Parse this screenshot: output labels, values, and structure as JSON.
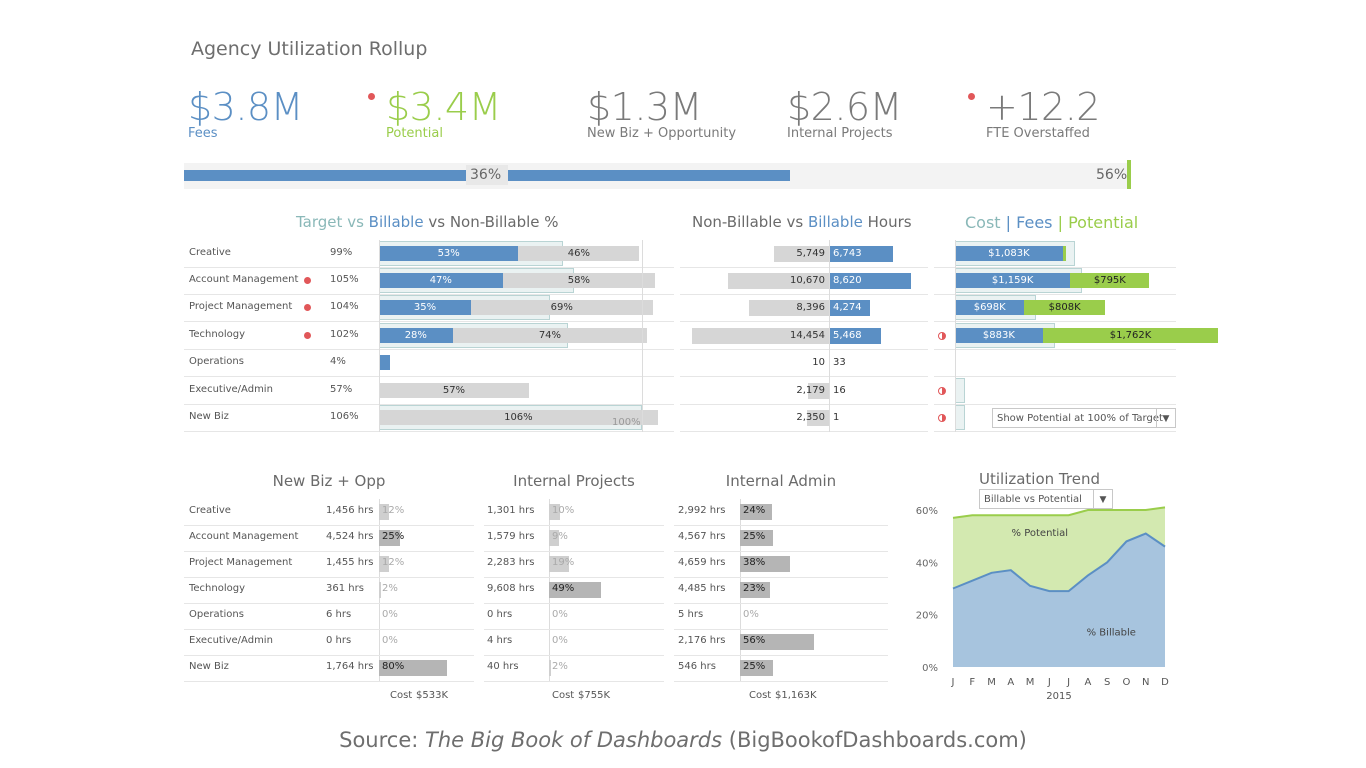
{
  "title": "Agency Utilization Rollup",
  "colors": {
    "blue": "#5b8fc4",
    "green": "#9acd4b",
    "teal": "#8ab8b8",
    "gray": "#d6d6d6",
    "red": "#e15759",
    "dark_gray": "#b5b5b5"
  },
  "kpis": [
    {
      "value": "$3.8M",
      "label": "Fees",
      "color": "#5b8fc4",
      "alert": false
    },
    {
      "value": "$3.4M",
      "label": "Potential",
      "color": "#9acd4b",
      "alert": true
    },
    {
      "value": "$1.3M",
      "label": "New Biz + Opportunity",
      "color": "#7a7a7a",
      "alert": false
    },
    {
      "value": "$2.6M",
      "label": "Internal Projects",
      "color": "#7a7a7a",
      "alert": false
    },
    {
      "value": "+12.2",
      "label": "FTE Overstaffed",
      "color": "#7a7a7a",
      "alert": true
    }
  ],
  "progress": {
    "fill_fraction": 0.64,
    "fill_label": "36%",
    "end_label": "56%"
  },
  "util_title": {
    "target": "Target",
    "vs1": "vs",
    "billable": "Billable",
    "rest": "vs Non-Billable %"
  },
  "hours_title": {
    "left": "Non-Billable vs",
    "billable": "Billable",
    "right": "Hours"
  },
  "money_title": {
    "cost": "Cost",
    "sep1": "|",
    "fees": "Fees",
    "sep2": "|",
    "potential": "Potential"
  },
  "departments": [
    {
      "name": "Creative",
      "alert": false,
      "util": "99%",
      "billable": 53,
      "nonbillable": 46,
      "target": 70,
      "nonbill_hrs": 5749,
      "bill_hrs": 6743,
      "cost_label": "$1,083K",
      "cost": 1083,
      "fees": 1083,
      "potential": null,
      "half": false
    },
    {
      "name": "Account Management",
      "alert": true,
      "util": "105%",
      "billable": 47,
      "nonbillable": 58,
      "target": 74,
      "nonbill_hrs": 10670,
      "bill_hrs": 8620,
      "cost_label": "$1,159K",
      "cost": 1159,
      "fees": 1159,
      "potential": 795,
      "potential_label": "$795K",
      "half": false
    },
    {
      "name": "Project Management",
      "alert": true,
      "util": "104%",
      "billable": 35,
      "nonbillable": 69,
      "target": 65,
      "nonbill_hrs": 8396,
      "bill_hrs": 4274,
      "cost_label": "$698K",
      "cost": 698,
      "fees": 698,
      "potential": 808,
      "potential_label": "$808K",
      "half": false
    },
    {
      "name": "Technology",
      "alert": true,
      "util": "102%",
      "billable": 28,
      "nonbillable": 74,
      "target": 72,
      "nonbill_hrs": 14454,
      "bill_hrs": 5468,
      "cost_label": "$883K",
      "cost": 883,
      "fees": 883,
      "potential": 1762,
      "potential_label": "$1,762K",
      "half": true
    },
    {
      "name": "Operations",
      "alert": false,
      "util": "4%",
      "billable": 4,
      "nonbillable": 0,
      "target": null,
      "nonbill_hrs": 10,
      "bill_hrs": 33,
      "cost_label": "",
      "cost": 0,
      "fees": 0,
      "potential": null,
      "half": false
    },
    {
      "name": "Executive/Admin",
      "alert": false,
      "util": "57%",
      "billable": 0,
      "nonbillable": 57,
      "target": null,
      "nonbill_hrs": 2179,
      "bill_hrs": 16,
      "cost_label": "",
      "cost": 0,
      "fees": 0,
      "potential": null,
      "half": true
    },
    {
      "name": "New Biz",
      "alert": false,
      "util": "106%",
      "billable": 0,
      "nonbillable": 106,
      "target": 100,
      "nonbill_hrs": 2350,
      "bill_hrs": 1,
      "cost_label": "",
      "cost": 0,
      "fees": 0,
      "potential": null,
      "half": true
    }
  ],
  "hours_labels": {
    "nonbill": [
      "5,749",
      "10,670",
      "8,396",
      "14,454",
      "10",
      "2,179",
      "2,350"
    ],
    "bill": [
      "6,743",
      "8,620",
      "4,274",
      "5,468",
      "33",
      "16",
      "1"
    ]
  },
  "nb_billable_labels": [
    "53%",
    "47%",
    "35%",
    "28%",
    "",
    "",
    ""
  ],
  "nb_nonbill_labels": [
    "46%",
    "58%",
    "69%",
    "74%",
    "",
    "57%",
    "106%"
  ],
  "target_marker_label": "100%",
  "potential_select": "Show Potential at 100% of Target",
  "bottom": {
    "newbiz": {
      "title": "New Biz + Opp",
      "hours": [
        "1,456 hrs",
        "4,524 hrs",
        "1,455 hrs",
        "361 hrs",
        "6 hrs",
        "0 hrs",
        "1,764 hrs"
      ],
      "pct": [
        12,
        25,
        12,
        2,
        0,
        0,
        80
      ],
      "pct_labels": [
        "12%",
        "25%",
        "12%",
        "2%",
        "0%",
        "0%",
        "80%"
      ],
      "cost_label": "Cost",
      "cost": "$533K"
    },
    "internal": {
      "title": "Internal Projects",
      "hours": [
        "1,301 hrs",
        "1,579 hrs",
        "2,283 hrs",
        "9,608 hrs",
        "0 hrs",
        "4 hrs",
        "40 hrs"
      ],
      "pct": [
        10,
        9,
        19,
        49,
        0,
        0,
        2
      ],
      "pct_labels": [
        "10%",
        "9%",
        "19%",
        "49%",
        "0%",
        "0%",
        "2%"
      ],
      "cost_label": "Cost",
      "cost": "$755K"
    },
    "admin": {
      "title": "Internal Admin",
      "hours": [
        "2,992 hrs",
        "4,567 hrs",
        "4,659 hrs",
        "4,485 hrs",
        "5 hrs",
        "2,176 hrs",
        "546 hrs"
      ],
      "pct": [
        24,
        25,
        38,
        23,
        0,
        56,
        25
      ],
      "pct_labels": [
        "24%",
        "25%",
        "38%",
        "23%",
        "0%",
        "56%",
        "25%"
      ],
      "cost_label": "Cost",
      "cost": "$1,163K"
    }
  },
  "trend": {
    "title": "Utilization Trend",
    "select": "Billable vs Potential",
    "year": "2015",
    "label_potential": "% Potential",
    "label_billable": "% Billable"
  },
  "chart_data": {
    "type": "area",
    "title": "Utilization Trend",
    "categories": [
      "J",
      "F",
      "M",
      "A",
      "M",
      "J",
      "J",
      "A",
      "S",
      "O",
      "N",
      "D"
    ],
    "series": [
      {
        "name": "% Billable",
        "values": [
          30,
          33,
          36,
          37,
          31,
          29,
          29,
          35,
          40,
          48,
          51,
          46
        ]
      },
      {
        "name": "% Potential",
        "values": [
          57,
          58,
          58,
          58,
          58,
          58,
          58,
          60,
          60,
          60,
          60,
          61
        ]
      }
    ],
    "ylim": [
      0,
      60
    ],
    "yticks": [
      "0%",
      "20%",
      "40%",
      "60%"
    ],
    "xlabel": "2015"
  },
  "source": {
    "prefix": "Source: ",
    "book": "The Big Book of Dashboards",
    "suffix": " (BigBookofDashboards.com)"
  }
}
